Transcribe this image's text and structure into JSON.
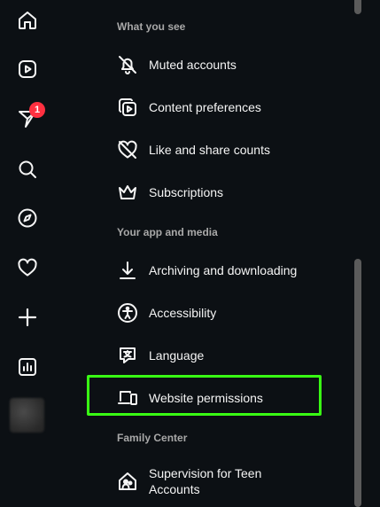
{
  "rail": {
    "notification_badge": "1"
  },
  "sections": {
    "what_you_see": "What you see",
    "your_app_and_media": "Your app and media",
    "family_center": "Family Center"
  },
  "items": {
    "muted_accounts": "Muted accounts",
    "content_preferences": "Content preferences",
    "like_and_share_counts": "Like and share counts",
    "subscriptions": "Subscriptions",
    "archiving_and_downloading": "Archiving and downloading",
    "accessibility": "Accessibility",
    "language": "Language",
    "website_permissions": "Website permissions",
    "supervision_for_teen_accounts": "Supervision for Teen Accounts"
  },
  "colors": {
    "background": "#0c1014",
    "badge": "#ff3040",
    "highlight": "#39ff14",
    "section_text": "#a8a8a8"
  },
  "icons": {
    "rail": [
      "home-icon",
      "reels-icon",
      "messages-icon",
      "search-icon",
      "explore-icon",
      "notifications-icon",
      "create-icon",
      "dashboard-icon"
    ],
    "settings": [
      "muted-bell-icon",
      "content-preferences-icon",
      "hidden-like-icon",
      "crown-icon",
      "download-icon",
      "accessibility-icon",
      "language-icon",
      "devices-icon",
      "family-house-icon"
    ]
  }
}
